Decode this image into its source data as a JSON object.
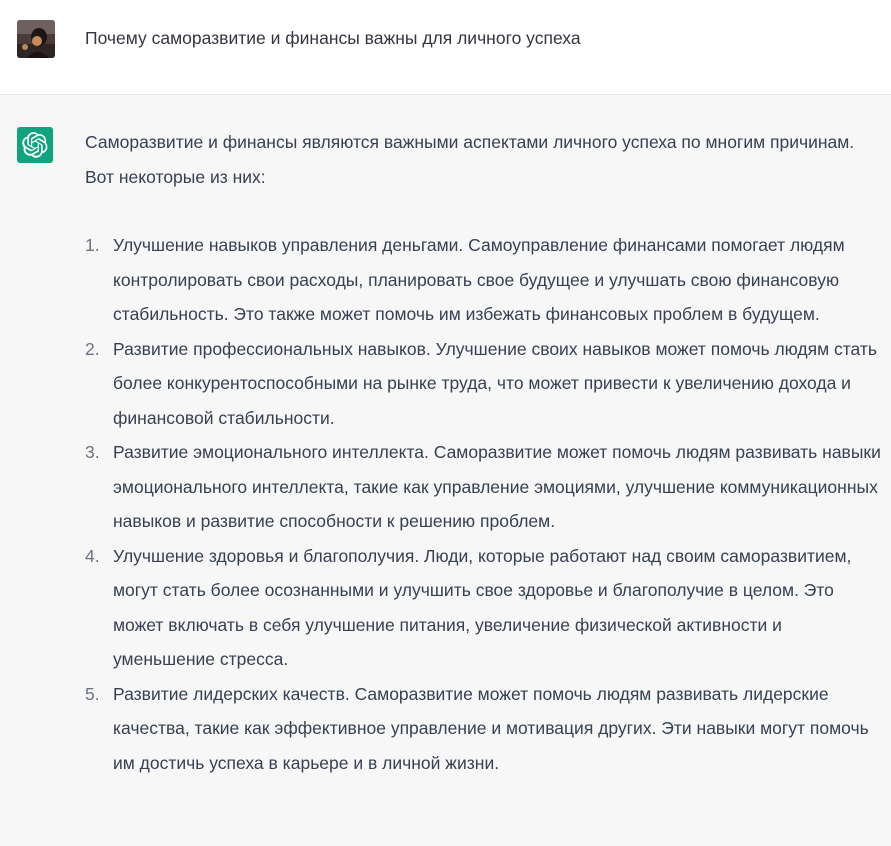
{
  "user_message": {
    "avatar_icon": "user-photo-avatar",
    "text": "Почему саморазвитие и финансы важны для личного успеха"
  },
  "assistant_message": {
    "avatar_icon": "openai-logo-icon",
    "avatar_color": "#10a37f",
    "intro": "Саморазвитие и финансы являются важными аспектами личного успеха по многим причинам. Вот некоторые из них:",
    "items": [
      {
        "number": "1.",
        "text": "Улучшение навыков управления деньгами. Самоуправление финансами помогает людям контролировать свои расходы, планировать свое будущее и улучшать свою финансовую стабильность. Это также может помочь им избежать финансовых проблем в будущем."
      },
      {
        "number": "2.",
        "text": "Развитие профессиональных навыков. Улучшение своих навыков может помочь людям стать более конкурентоспособными на рынке труда, что может привести к увеличению дохода и финансовой стабильности."
      },
      {
        "number": "3.",
        "text": "Развитие эмоционального интеллекта. Саморазвитие может помочь людям развивать навыки эмоционального интеллекта, такие как управление эмоциями, улучшение коммуникационных навыков и развитие способности к решению проблем."
      },
      {
        "number": "4.",
        "text": "Улучшение здоровья и благополучия. Люди, которые работают над своим саморазвитием, могут стать более осознанными и улучшить свое здоровье и благополучие в целом. Это может включать в себя улучшение питания, увеличение физической активности и уменьшение стресса."
      },
      {
        "number": "5.",
        "text": "Развитие лидерских качеств. Саморазвитие может помочь людям развивать лидерские качества, такие как эффективное управление и мотивация других. Эти навыки могут помочь им достичь успеха в карьере и в личной жизни."
      }
    ]
  }
}
